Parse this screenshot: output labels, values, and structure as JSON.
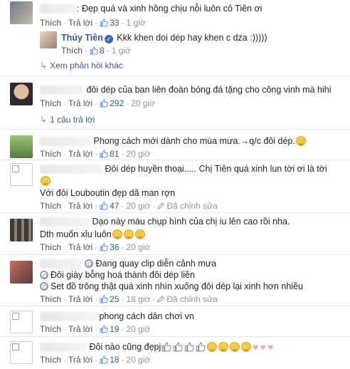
{
  "colors": {
    "link": "#365899",
    "meta": "#90949c",
    "text": "#1d2129"
  },
  "actions": {
    "like": "Thích",
    "reply": "Trả lời",
    "edited": "Đã chỉnh sửa"
  },
  "comments": [
    {
      "text": ": Đẹp quá và xinh hồng chịu nỗi luôn cô Tiên ơi",
      "likes": "33",
      "time": "1 giờ",
      "reply": {
        "name": "Thủy Tiên",
        "text": "Kkk khen doi dép hay khen c dza :)))))",
        "likes": "8",
        "time": "1 giờ"
      },
      "more_replies": "Xem phản hồi khác"
    },
    {
      "text": "đôi dép của ban liên đoàn bóng đá tặng cho công vinh mà hihi",
      "likes": "292",
      "time": "20 giờ",
      "replies": "1 câu trả lời"
    },
    {
      "text": "Phong cách mới dành cho mùa mưa.→q/c đôi dép.",
      "likes": "81",
      "time": "20 giờ"
    },
    {
      "text": "Đôi dép huyền thoại..... Chị Tiên quá xinh lun tời ơi là tời",
      "text2": "Với đôi Louboutin đẹp dã man rợn",
      "likes": "47",
      "time": "20 giờ"
    },
    {
      "text": "Dạo này máu chụp hình của chị iu lên cao rồi nha.",
      "text2": "Dth muốn xỉu luôn",
      "likes": "36",
      "time": "20 giờ"
    },
    {
      "text": "Đang quay clip diễn cảnh mưa",
      "text2": "Đôi giày bỗng hoá thành đôi dép liền",
      "text3": "Set đồ trông thật quá xinh nhìn xuống đôi dép lại xinh hơn nhiều",
      "likes": "25",
      "time": "18 giờ"
    },
    {
      "text": "phong cách dân chơi vn",
      "likes": "19",
      "time": "20 giờ"
    },
    {
      "text": "Đôi nào cũng đẹpj",
      "likes": "18",
      "time": "20 giờ"
    }
  ]
}
